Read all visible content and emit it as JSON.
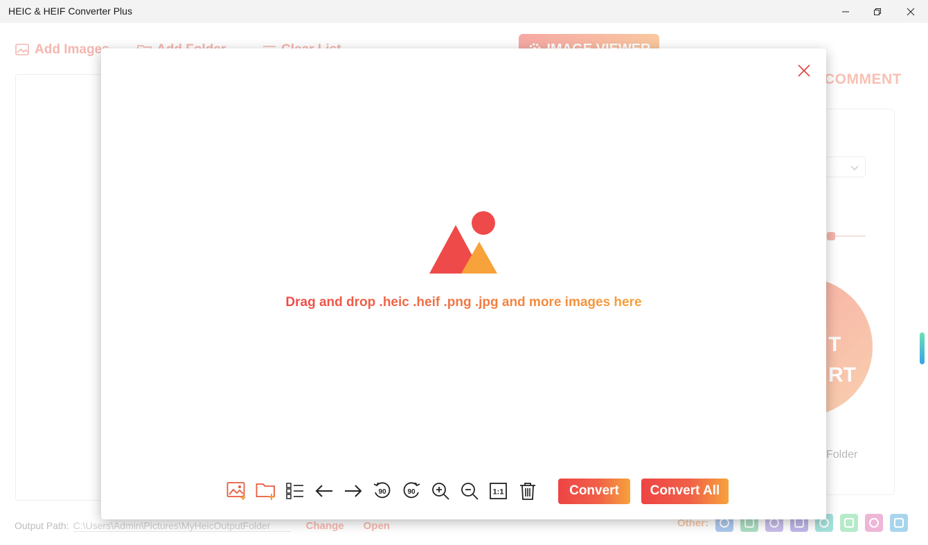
{
  "window": {
    "title": "HEIC & HEIF Converter Plus"
  },
  "background": {
    "toolbar": {
      "add_images": "Add Images",
      "add_folder": "Add Folder",
      "clear_list": "Clear List"
    },
    "image_viewer_label": "IMAGE VIEWER",
    "comment_label": "COMMENT",
    "convert_circle_lines": [
      "T",
      "RT"
    ],
    "open_folder_label": "Folder",
    "output": {
      "label": "Output Path:",
      "path": "C:\\Users\\Admin\\Pictures\\MyHeicOutputFolder",
      "change": "Change",
      "open": "Open"
    },
    "other": {
      "label": "Other:",
      "icons": [
        "app-icon-1",
        "app-icon-2",
        "app-icon-3",
        "app-icon-4",
        "app-icon-5",
        "app-icon-6",
        "app-icon-7",
        "app-icon-8"
      ],
      "icon_colors": [
        "#8fb6e8",
        "#8fd4b0",
        "#b5a6e6",
        "#a9a0e2",
        "#86d6d0",
        "#9fe3b7",
        "#e89ec9",
        "#8cc7e8"
      ]
    }
  },
  "modal": {
    "drop_text": "Drag and drop .heic .heif .png .jpg and more images here",
    "colors": {
      "accent_red": "#ef4a4a",
      "accent_orange": "#f7a23b",
      "close_color": "#e34848"
    },
    "toolbar_icons": [
      "add-image-icon",
      "add-folder-icon",
      "list-view-icon",
      "previous-arrow-icon",
      "next-arrow-icon",
      "rotate-left-90-icon",
      "rotate-right-90-icon",
      "zoom-in-icon",
      "zoom-out-icon",
      "actual-size-icon",
      "delete-icon"
    ],
    "rotate_label": "90",
    "actual_size_label": "1:1",
    "convert_label": "Convert",
    "convert_all_label": "Convert All"
  }
}
